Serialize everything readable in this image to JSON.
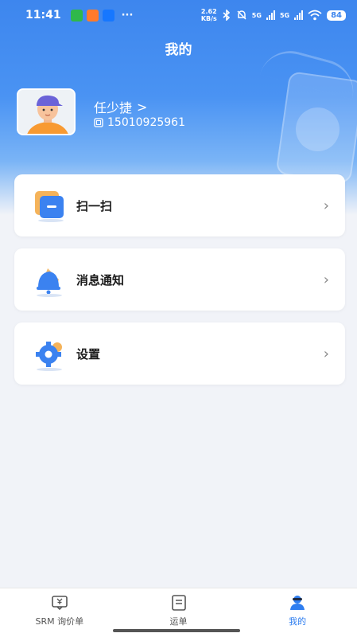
{
  "status_bar": {
    "time": "11:41",
    "more": "···",
    "net_speed_value": "2.62",
    "net_speed_unit": "KB/s",
    "signal1_label": "5G",
    "signal2_label": "5G",
    "battery": "84"
  },
  "header": {
    "title": "我的"
  },
  "user": {
    "name": "任少捷",
    "chevron": ">",
    "phone": "15010925961"
  },
  "menu": {
    "items": [
      {
        "label": "扫一扫",
        "icon": "scan-icon"
      },
      {
        "label": "消息通知",
        "icon": "bell-icon"
      },
      {
        "label": "设置",
        "icon": "gear-icon"
      }
    ],
    "chevron": "›"
  },
  "bottom_nav": {
    "items": [
      {
        "label": "SRM 询价单",
        "icon": "inquiry-icon"
      },
      {
        "label": "运单",
        "icon": "waybill-icon"
      },
      {
        "label": "我的",
        "icon": "profile-icon"
      }
    ],
    "active_index": 2,
    "active_color": "#2f7ef0"
  },
  "colors": {
    "header_blue": "#3d86ee",
    "background": "#f1f3f8"
  }
}
